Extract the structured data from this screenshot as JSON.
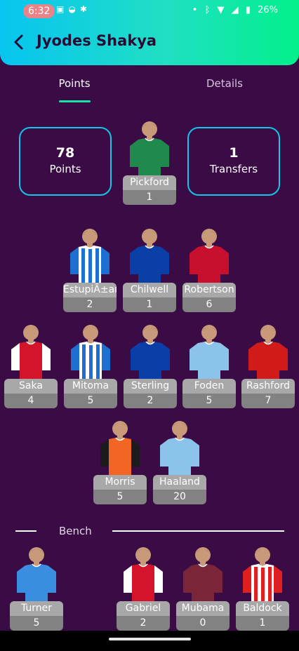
{
  "status_bar": {
    "time": "6:32",
    "battery": "26%",
    "icons": [
      "google-pay-icon",
      "bowl-icon",
      "bug-icon",
      "dot-icon",
      "bluetooth-icon",
      "vibrate-icon",
      "wifi-icon",
      "signal-icon",
      "battery-icon"
    ]
  },
  "header": {
    "title": "Jyodes Shakya",
    "back_icon": "arrow-left-icon"
  },
  "tabs": {
    "points": "Points",
    "details": "Details"
  },
  "summary": {
    "points_value": "78",
    "points_label": "Points",
    "transfers_value": "1",
    "transfers_label": "Transfers"
  },
  "goalkeeper": {
    "name": "Pickford",
    "points": "1",
    "kit": "everton-gk"
  },
  "defenders": [
    {
      "name": "EstupiÃ±an",
      "points": "2",
      "kit": "brighton"
    },
    {
      "name": "Chilwell",
      "points": "1",
      "kit": "chelsea"
    },
    {
      "name": "Robertson",
      "points": "6",
      "kit": "liverpool"
    }
  ],
  "midfielders": [
    {
      "name": "Saka",
      "points": "4",
      "kit": "arsenal"
    },
    {
      "name": "Mitoma",
      "points": "5",
      "kit": "brighton"
    },
    {
      "name": "Sterling",
      "points": "2",
      "kit": "chelsea"
    },
    {
      "name": "Foden",
      "points": "5",
      "kit": "man-city"
    },
    {
      "name": "Rashford",
      "points": "7",
      "kit": "man-utd"
    }
  ],
  "forwards": [
    {
      "name": "Morris",
      "points": "5",
      "kit": "luton"
    },
    {
      "name": "Haaland",
      "points": "20",
      "kit": "man-city"
    }
  ],
  "bench": {
    "label": "Bench",
    "players": [
      {
        "name": "Turner",
        "points": "5",
        "kit": "forest-gk"
      },
      {
        "name": "Gabriel",
        "points": "2",
        "kit": "arsenal"
      },
      {
        "name": "Mubama",
        "points": "0",
        "kit": "west-ham"
      },
      {
        "name": "Baldock",
        "points": "1",
        "kit": "sheffield-utd"
      }
    ]
  },
  "colors": {
    "background": "#3a0b45",
    "header_gradient_start": "#07c4f0",
    "header_gradient_end": "#02f08b",
    "accent": "#19e6a6",
    "stat_border": "#14c6e9",
    "name_bar": "#a8a8a8",
    "points_bar": "#828282"
  }
}
